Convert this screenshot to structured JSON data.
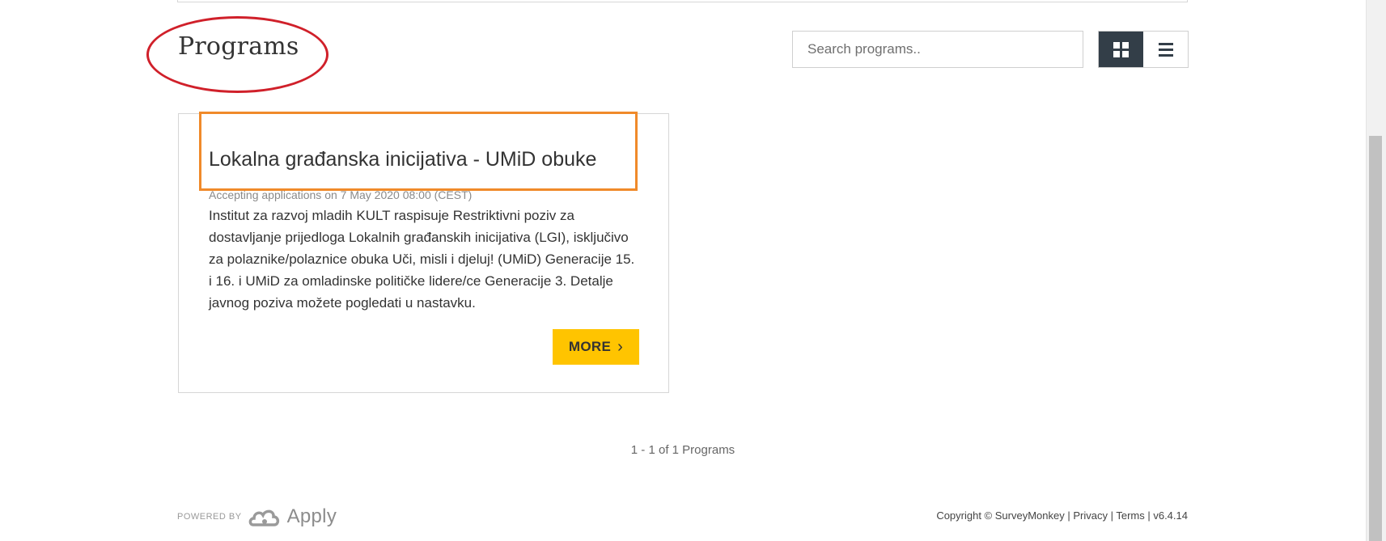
{
  "header": {
    "title": "Programs",
    "search_placeholder": "Search programs.."
  },
  "view_toggle": {
    "grid_icon": "grid-icon",
    "list_icon": "list-icon",
    "active": "grid"
  },
  "program": {
    "title": "Lokalna građanska inicijativa - UMiD obuke",
    "status": "Accepting applications on 7 May 2020 08:00 (CEST)",
    "description": "Institut za razvoj mladih KULT raspisuje Restriktivni poziv za dostavljanje prijedloga Lokalnih građanskih inicijativa (LGI), isključivo za polaznike/polaznice obuka Uči, misli i djeluj! (UMiD) Generacije 15. i 16. i UMiD za omladinske političke lidere/ce Generacije 3. Detalje javnog poziva možete pogledati u nastavku.",
    "more_label": "MORE"
  },
  "pager": {
    "text": "1 - 1 of 1 Programs"
  },
  "footer": {
    "powered_by": "POWERED BY",
    "brand": "Apply",
    "copyright": "Copyright © SurveyMonkey",
    "privacy": "Privacy",
    "terms": "Terms",
    "version": "v6.4.14"
  },
  "colors": {
    "accent": "#ffc400",
    "toggle_active": "#333e48",
    "annotation_circle": "#d0202a",
    "annotation_box": "#f08a2a"
  }
}
